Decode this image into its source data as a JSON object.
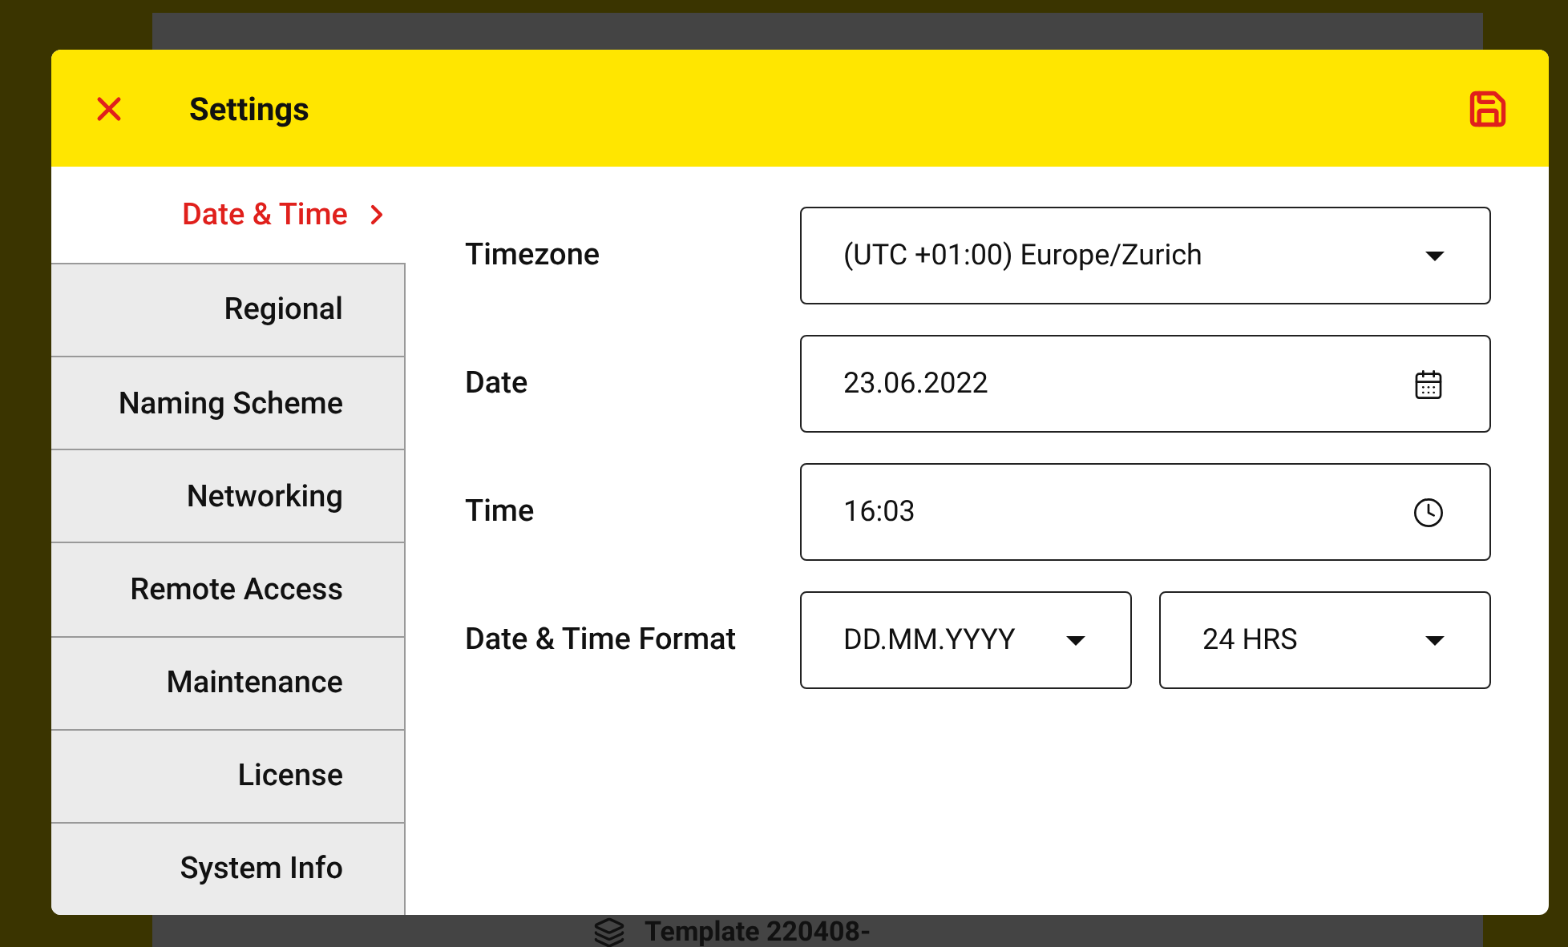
{
  "background": {
    "template_title": "Template 220408-"
  },
  "dialog": {
    "title": "Settings"
  },
  "sidebar": {
    "items": [
      {
        "label": "Date & Time",
        "selected": true
      },
      {
        "label": "Regional",
        "selected": false
      },
      {
        "label": "Naming Scheme",
        "selected": false
      },
      {
        "label": "Networking",
        "selected": false
      },
      {
        "label": "Remote Access",
        "selected": false
      },
      {
        "label": "Maintenance",
        "selected": false
      },
      {
        "label": "License",
        "selected": false
      },
      {
        "label": "System Info",
        "selected": false
      }
    ]
  },
  "form": [
    {
      "label": "Timezone",
      "fields": [
        {
          "kind": "dropdown",
          "value": "(UTC +01:00) Europe/Zurich"
        }
      ]
    },
    {
      "label": "Date",
      "fields": [
        {
          "kind": "date",
          "value": "23.06.2022"
        }
      ]
    },
    {
      "label": "Time",
      "fields": [
        {
          "kind": "time",
          "value": "16:03"
        }
      ]
    },
    {
      "label": "Date & Time Format",
      "fields": [
        {
          "kind": "dropdown",
          "value": "DD.MM.YYYY"
        },
        {
          "kind": "dropdown",
          "value": "24 HRS"
        }
      ]
    }
  ]
}
